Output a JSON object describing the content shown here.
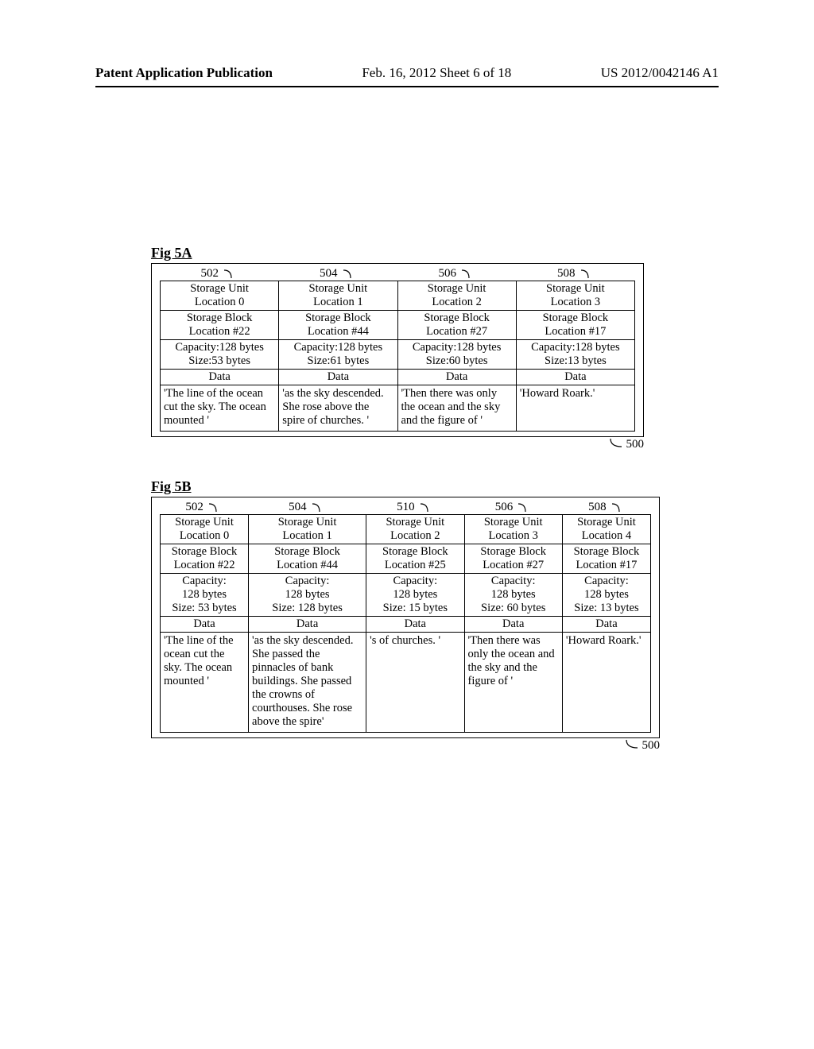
{
  "header": {
    "left": "Patent Application Publication",
    "center": "Feb. 16, 2012  Sheet 6 of 18",
    "right": "US 2012/0042146 A1"
  },
  "figA": {
    "title": "Fig 5A",
    "container_ref": "500",
    "refs": [
      "502",
      "504",
      "506",
      "508"
    ],
    "columns": [
      {
        "unit_label": "Storage Unit",
        "unit_loc": "Location 0",
        "block_label": "Storage Block",
        "block_loc": "Location #22",
        "capacity": "Capacity:128 bytes",
        "size": "Size:53 bytes",
        "data_label": "Data",
        "data": "'The line of the ocean cut the sky. The ocean mounted '"
      },
      {
        "unit_label": "Storage Unit",
        "unit_loc": "Location 1",
        "block_label": "Storage Block",
        "block_loc": "Location #44",
        "capacity": "Capacity:128 bytes",
        "size": "Size:61 bytes",
        "data_label": "Data",
        "data": "'as the sky descended. She rose above the spire of churches. '"
      },
      {
        "unit_label": "Storage Unit",
        "unit_loc": "Location 2",
        "block_label": "Storage Block",
        "block_loc": "Location #27",
        "capacity": "Capacity:128 bytes",
        "size": "Size:60 bytes",
        "data_label": "Data",
        "data": "'Then there was only the ocean and the sky and the figure of '"
      },
      {
        "unit_label": "Storage Unit",
        "unit_loc": "Location 3",
        "block_label": "Storage Block",
        "block_loc": "Location #17",
        "capacity": "Capacity:128 bytes",
        "size": "Size:13 bytes",
        "data_label": "Data",
        "data": "'Howard Roark.'"
      }
    ]
  },
  "figB": {
    "title": "Fig 5B",
    "container_ref": "500",
    "refs": [
      "502",
      "504",
      "510",
      "506",
      "508"
    ],
    "columns": [
      {
        "unit_label": "Storage Unit",
        "unit_loc": "Location 0",
        "block_label": "Storage Block",
        "block_loc": "Location #22",
        "capacity_l1": "Capacity:",
        "capacity_l2": "128 bytes",
        "size": "Size: 53 bytes",
        "data_label": "Data",
        "data": "'The line of the ocean cut the sky. The ocean mounted '"
      },
      {
        "unit_label": "Storage Unit",
        "unit_loc": "Location 1",
        "block_label": "Storage Block",
        "block_loc": "Location #44",
        "capacity_l1": "Capacity:",
        "capacity_l2": "128 bytes",
        "size": "Size: 128 bytes",
        "data_label": "Data",
        "data": "'as the sky descended. She passed the pinnacles of bank buildings. She passed the crowns of courthouses.  She rose above the spire'"
      },
      {
        "unit_label": "Storage Unit",
        "unit_loc": "Location 2",
        "block_label": "Storage Block",
        "block_loc": "Location #25",
        "capacity_l1": "Capacity:",
        "capacity_l2": "128 bytes",
        "size": "Size: 15 bytes",
        "data_label": "Data",
        "data": "'s of churches. '"
      },
      {
        "unit_label": "Storage Unit",
        "unit_loc": "Location 3",
        "block_label": "Storage Block",
        "block_loc": "Location #27",
        "capacity_l1": "Capacity:",
        "capacity_l2": "128 bytes",
        "size": "Size: 60 bytes",
        "data_label": "Data",
        "data": "'Then there was only the ocean and the sky and the figure of '"
      },
      {
        "unit_label": "Storage Unit",
        "unit_loc": "Location 4",
        "block_label": "Storage Block",
        "block_loc": "Location #17",
        "capacity_l1": "Capacity:",
        "capacity_l2": "128 bytes",
        "size": "Size: 13 bytes",
        "data_label": "Data",
        "data": "'Howard Roark.'"
      }
    ]
  }
}
